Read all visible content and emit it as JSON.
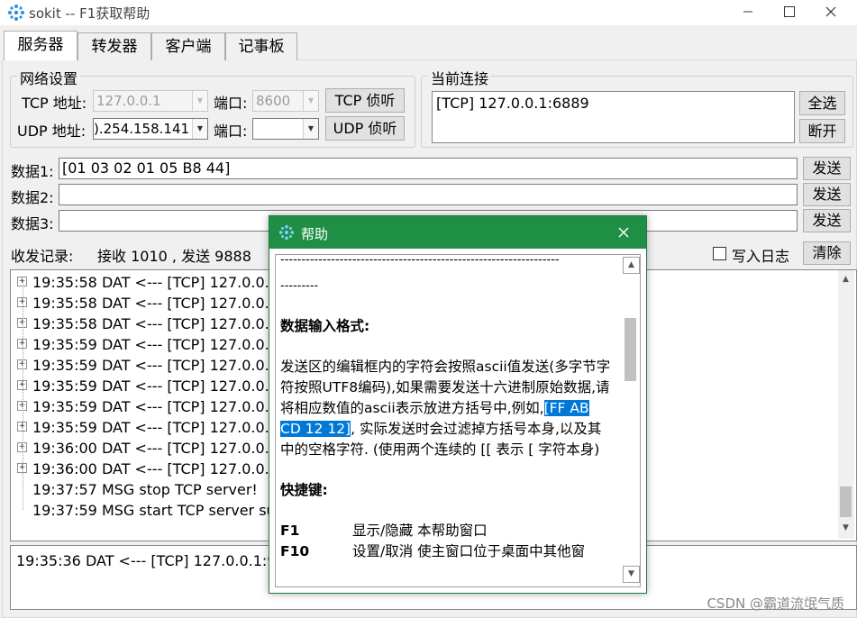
{
  "window": {
    "title": "sokit -- F1获取帮助",
    "minimize_icon": "minimize-icon",
    "maximize_icon": "maximize-icon",
    "close_icon": "close-icon"
  },
  "tabs": [
    {
      "label": "服务器",
      "active": true
    },
    {
      "label": "转发器",
      "active": false
    },
    {
      "label": "客户端",
      "active": false
    },
    {
      "label": "记事板",
      "active": false
    }
  ],
  "network": {
    "legend": "网络设置",
    "tcp_label": "TCP 地址:",
    "tcp_addr": "127.0.0.1",
    "tcp_port_label": "端口:",
    "tcp_port": "8600",
    "tcp_listen": "TCP 侦听",
    "udp_label": "UDP 地址:",
    "udp_addr": ").254.158.141",
    "udp_port_label": "端口:",
    "udp_port": "",
    "udp_listen": "UDP 侦听"
  },
  "connections": {
    "legend": "当前连接",
    "items": [
      "[TCP] 127.0.0.1:6889"
    ],
    "select_all": "全选",
    "disconnect": "断开"
  },
  "data_rows": [
    {
      "label": "数据1:",
      "value": "[01 03 02 01 05 B8 44]",
      "send": "发送"
    },
    {
      "label": "数据2:",
      "value": "",
      "send": "发送"
    },
    {
      "label": "数据3:",
      "value": "",
      "send": "发送"
    }
  ],
  "log": {
    "label": "收发记录:",
    "stats": "接收 1010 , 发送 9888",
    "write_log": "写入日志",
    "clear": "清除",
    "entries": [
      {
        "text": "19:35:58 DAT <--- [TCP] 127.0.0.",
        "expandable": true
      },
      {
        "text": "19:35:58 DAT <--- [TCP] 127.0.0.",
        "expandable": true
      },
      {
        "text": "19:35:58 DAT <--- [TCP] 127.0.0.",
        "expandable": true
      },
      {
        "text": "19:35:59 DAT <--- [TCP] 127.0.0.",
        "expandable": true
      },
      {
        "text": "19:35:59 DAT <--- [TCP] 127.0.0.",
        "expandable": true
      },
      {
        "text": "19:35:59 DAT <--- [TCP] 127.0.0.",
        "expandable": true
      },
      {
        "text": "19:35:59 DAT <--- [TCP] 127.0.0.",
        "expandable": true
      },
      {
        "text": "19:35:59 DAT <--- [TCP] 127.0.0.",
        "expandable": true
      },
      {
        "text": "19:36:00 DAT <--- [TCP] 127.0.0.",
        "expandable": true
      },
      {
        "text": "19:36:00 DAT <--- [TCP] 127.0.0.",
        "expandable": true
      },
      {
        "text": "19:37:57 MSG stop TCP server!",
        "expandable": false
      },
      {
        "text": "19:37:59 MSG start TCP server su",
        "expandable": false
      }
    ],
    "detail": "19:35:36 DAT <--- [TCP] 127.0.0.1:9"
  },
  "help_dialog": {
    "title": "帮助",
    "icon": "sokit-logo-icon",
    "close_icon": "close-icon",
    "dashes_1": "------------------------------------------------------------------",
    "dashes_2": "---------",
    "heading_format": "数据输入格式:",
    "para_1": "发送区的编辑框内的字符会按照ascii值发送(多字节字符按照UTF8编码),如果需要发送十六进制原始数据,请将相应数值的ascii表示放进方括号中,例如,",
    "para_highlight": "[FF AB CD 12 12]",
    "para_2": ", 实际发送时会过滤掉方括号本身,以及其中的空格字符. (使用两个连续的 [[ 表示 [ 字符本身)",
    "heading_shortcuts": "快捷键:",
    "shortcuts": [
      {
        "key": "F1",
        "desc": "显示/隐藏 本帮助窗口"
      },
      {
        "key": "F10",
        "desc": "设置/取消 使主窗口位于桌面中其他窗"
      }
    ]
  },
  "watermark": "CSDN @霸道流氓气质"
}
